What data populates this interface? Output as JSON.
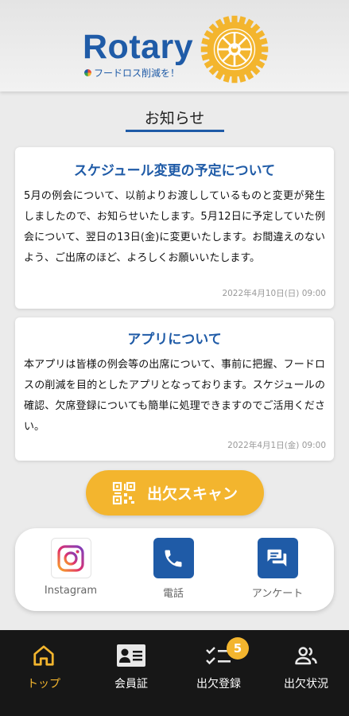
{
  "header": {
    "brand": "Rotary",
    "tagline": "フードロス削減を！",
    "emblem_text": "ROTARY INTERNATIONAL"
  },
  "section": {
    "title": "お知らせ"
  },
  "notices": [
    {
      "title": "スケジュール変更の予定について",
      "body": "5月の例会について、以前よりお渡ししているものと変更が発生しましたので、お知らせいたします。5月12日に予定していた例会について、翌日の13日(金)に変更いたします。お間違えのないよう、ご出席のほど、よろしくお願いいたします。",
      "date": "2022年4月10日(日) 09:00"
    },
    {
      "title": "アプリについて",
      "body": "本アプリは皆様の例会等の出席について、事前に把握、フードロスの削減を目的としたアプリとなっております。スケジュールの確認、欠席登録についても簡単に処理できますのでご活用ください。",
      "date": "2022年4月1日(金) 09:00"
    }
  ],
  "scan_button": {
    "label": "出欠スキャン",
    "icon": "qr-code-icon"
  },
  "links": [
    {
      "label": "Instagram",
      "icon": "instagram-icon"
    },
    {
      "label": "電話",
      "icon": "phone-icon"
    },
    {
      "label": "アンケート",
      "icon": "chat-icon"
    }
  ],
  "tabs": [
    {
      "label": "トップ",
      "icon": "home-icon",
      "active": true
    },
    {
      "label": "会員証",
      "icon": "member-card-icon"
    },
    {
      "label": "出欠登録",
      "icon": "checklist-icon",
      "badge": "5"
    },
    {
      "label": "出欠状況",
      "icon": "people-icon"
    }
  ],
  "colors": {
    "brand_blue": "#1f5ba7",
    "accent_gold": "#f3b52e",
    "tabbar_bg": "#171717"
  }
}
